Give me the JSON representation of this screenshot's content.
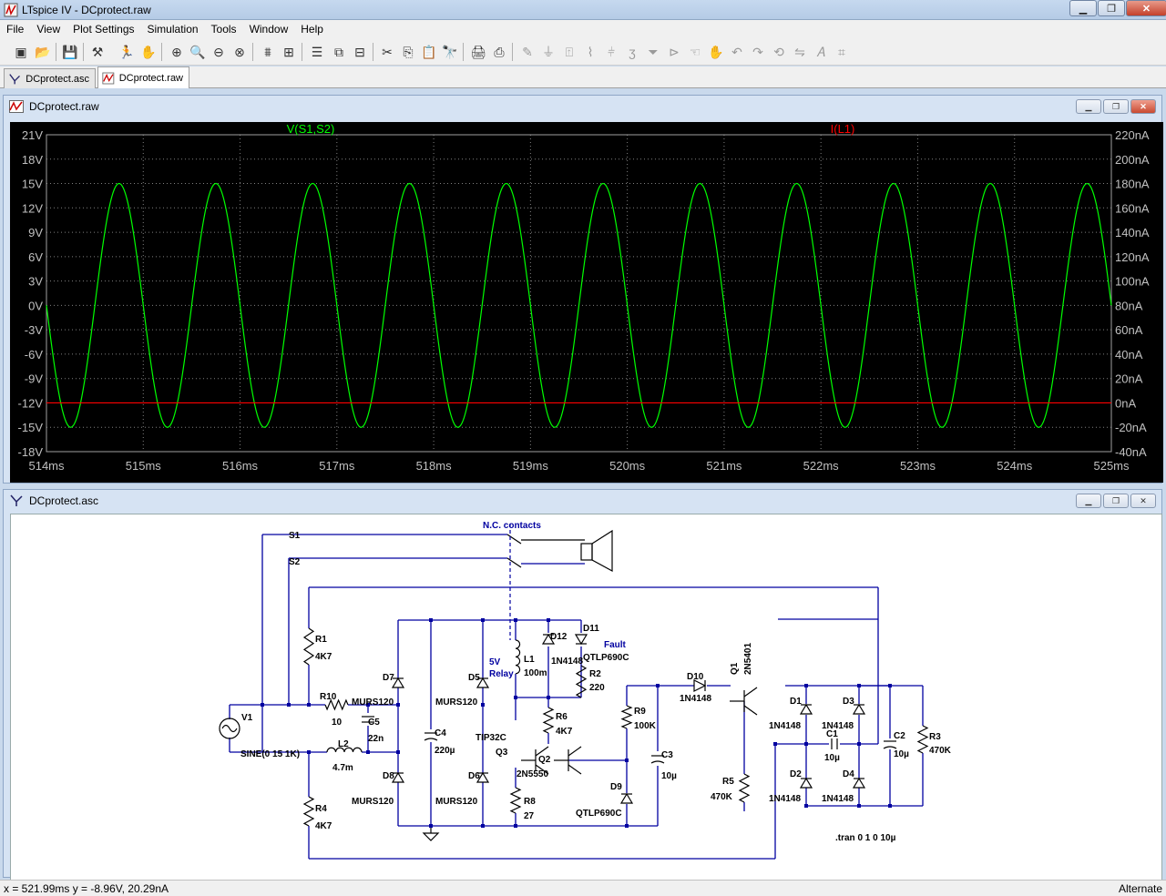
{
  "window": {
    "title": "LTspice IV - DCprotect.raw",
    "min": "▁",
    "max": "❐",
    "close": "✕"
  },
  "menu": [
    "File",
    "View",
    "Plot Settings",
    "Simulation",
    "Tools",
    "Window",
    "Help"
  ],
  "toolbar_icons": [
    "open-schematic-icon",
    "open-file-icon",
    "save-icon",
    "control-panel-icon",
    "run-icon",
    "pan-hand-icon",
    "zoom-in-icon",
    "zoom-box-icon",
    "zoom-out-icon",
    "zoom-cancel-icon",
    "autorange-icon",
    "zoom-fit-icon",
    "tile-horizontal-icon",
    "cascade-icon",
    "tile-vertical-icon",
    "cut-icon",
    "copy-icon",
    "paste-icon",
    "find-icon",
    "print-setup-icon",
    "print-icon",
    "wire-icon",
    "ground-icon",
    "label-net-icon",
    "resistor-icon",
    "capacitor-icon",
    "inductor-icon",
    "diode-icon",
    "component-icon",
    "move-icon",
    "drag-icon",
    "undo-icon",
    "redo-icon",
    "rotate-icon",
    "mirror-icon",
    "text-icon",
    "spice-directive-icon"
  ],
  "tabs": [
    {
      "label": "DCprotect.asc",
      "active": false
    },
    {
      "label": "DCprotect.raw",
      "active": true
    }
  ],
  "plot_window": {
    "title": "DCprotect.raw",
    "bg": "#000000",
    "grid": "#808080",
    "trace1": {
      "name": "V(S1,S2)",
      "color": "#00ff00"
    },
    "trace2": {
      "name": "I(L1)",
      "color": "#ff0000"
    }
  },
  "chart_data": {
    "type": "line",
    "title": "",
    "x_unit": "ms",
    "x_ticks": [
      "514ms",
      "515ms",
      "516ms",
      "517ms",
      "518ms",
      "519ms",
      "520ms",
      "521ms",
      "522ms",
      "523ms",
      "524ms",
      "525ms"
    ],
    "xlim": [
      514,
      525
    ],
    "y_left_ticks": [
      "21V",
      "18V",
      "15V",
      "12V",
      "9V",
      "6V",
      "3V",
      "0V",
      "-3V",
      "-6V",
      "-9V",
      "-12V",
      "-15V",
      "-18V"
    ],
    "ylim_left": [
      -18,
      21
    ],
    "y_right_ticks": [
      "220nA",
      "200nA",
      "180nA",
      "160nA",
      "140nA",
      "120nA",
      "100nA",
      "80nA",
      "60nA",
      "40nA",
      "20nA",
      "0nA",
      "-20nA",
      "-40nA"
    ],
    "ylim_right": [
      -40,
      220
    ],
    "series": [
      {
        "name": "V(S1,S2)",
        "axis": "left",
        "kind": "sine",
        "amplitude": 15,
        "frequency_khz": 1,
        "phase_deg": 180,
        "unit": "V"
      },
      {
        "name": "I(L1)",
        "axis": "right",
        "kind": "constant",
        "value": 0,
        "unit": "nA"
      }
    ],
    "grid": true
  },
  "schematic_window": {
    "title": "DCprotect.asc",
    "wire_color": "#000080",
    "labels": {
      "nc": "N.C. contacts",
      "s1": "S1",
      "s2": "S2",
      "fault": "Fault",
      "relay": "5V\nRelay",
      "tran": ".tran 0 1 0 10µ",
      "sine": "SINE(0 15 1K)"
    },
    "parts": [
      {
        "ref": "V1",
        "val": ""
      },
      {
        "ref": "R10",
        "val": "10"
      },
      {
        "ref": "C5",
        "val": "22n"
      },
      {
        "ref": "L2",
        "val": "4.7m"
      },
      {
        "ref": "R1",
        "val": "4K7"
      },
      {
        "ref": "R4",
        "val": "4K7"
      },
      {
        "ref": "D7",
        "val": "MURS120"
      },
      {
        "ref": "D8",
        "val": "MURS120"
      },
      {
        "ref": "C4",
        "val": "220µ"
      },
      {
        "ref": "D5",
        "val": "MURS120"
      },
      {
        "ref": "D6",
        "val": "MURS120"
      },
      {
        "ref": "Q3",
        "val": "TIP32C"
      },
      {
        "ref": "L1",
        "val": "100m"
      },
      {
        "ref": "D12",
        "val": "1N4148"
      },
      {
        "ref": "D11",
        "val": "QTLP690C"
      },
      {
        "ref": "R2",
        "val": "220"
      },
      {
        "ref": "R6",
        "val": "4K7"
      },
      {
        "ref": "Q2",
        "val": "2N5550"
      },
      {
        "ref": "R8",
        "val": "27"
      },
      {
        "ref": "D9",
        "val": "QTLP690C"
      },
      {
        "ref": "R9",
        "val": "100K"
      },
      {
        "ref": "C3",
        "val": "10µ"
      },
      {
        "ref": "D10",
        "val": "1N4148"
      },
      {
        "ref": "Q1",
        "val": "2N5401"
      },
      {
        "ref": "R5",
        "val": "470K"
      },
      {
        "ref": "D1",
        "val": "1N4148"
      },
      {
        "ref": "D2",
        "val": "1N4148"
      },
      {
        "ref": "D3",
        "val": "1N4148"
      },
      {
        "ref": "D4",
        "val": "1N4148"
      },
      {
        "ref": "C1",
        "val": "10µ"
      },
      {
        "ref": "C2",
        "val": "10µ"
      },
      {
        "ref": "R3",
        "val": "470K"
      }
    ]
  },
  "status": {
    "coords": "x = 521.99ms    y = -8.96V, 20.29nA",
    "mode": "Alternate"
  }
}
